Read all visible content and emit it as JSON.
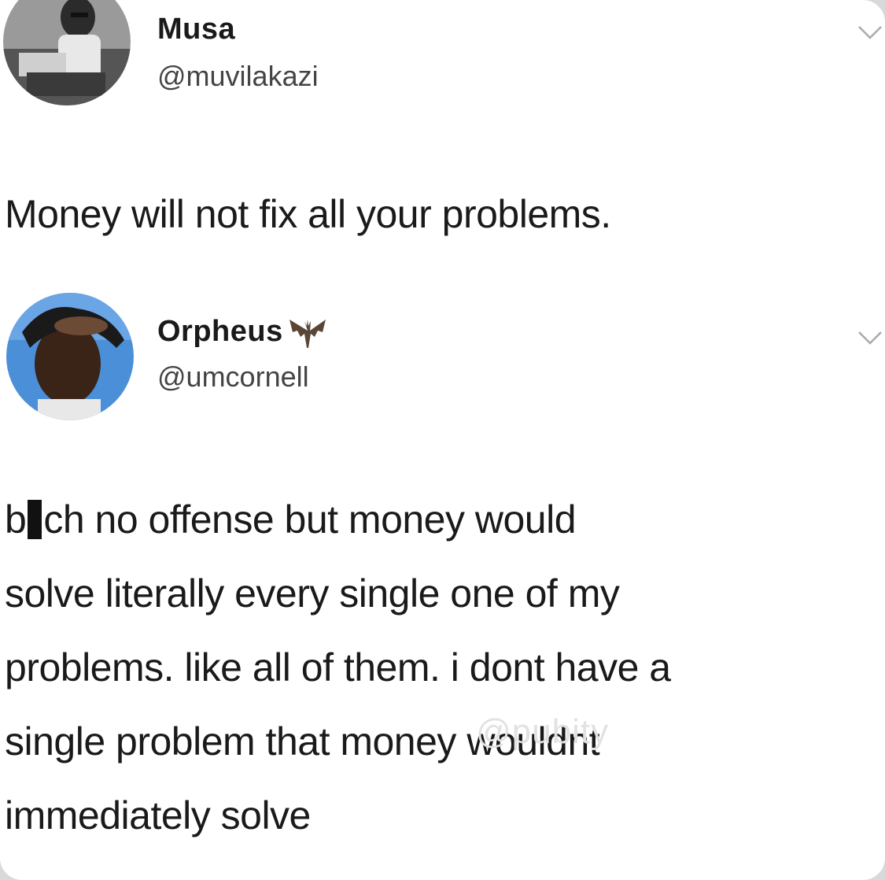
{
  "tweets": [
    {
      "name": "Musa",
      "handle": "@muvilakazi",
      "text": "Money will not fix all your problems."
    },
    {
      "name": "Orpheus",
      "name_emoji": "bat-icon",
      "handle": "@umcornell",
      "text_line1_pre": "b",
      "text_line1_post": "ch no offense but money would",
      "text_line2": "solve literally every single one of my",
      "text_line3": "problems. like all of them. i dont have a",
      "text_line4": "single problem that money wouldnt",
      "text_line5": "immediately solve"
    }
  ],
  "watermark": "@pubity",
  "colors": {
    "text": "#1a1a1a",
    "handle": "#444444",
    "background": "#ffffff",
    "censor_bar": "#111111"
  }
}
